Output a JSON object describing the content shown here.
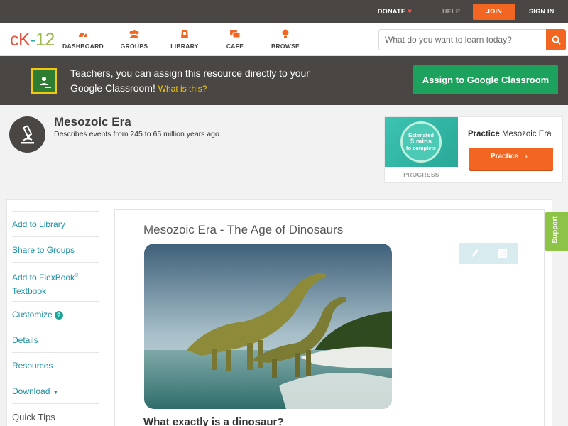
{
  "topbar": {
    "donate": "DONATE",
    "help": "HELP",
    "join": "JOIN",
    "signin": "SIGN IN"
  },
  "header": {
    "logo": {
      "l1": "cK",
      "l2": "-",
      "l3": "12"
    },
    "nav": [
      {
        "label": "DASHBOARD",
        "icon": "dashboard-icon"
      },
      {
        "label": "GROUPS",
        "icon": "groups-icon"
      },
      {
        "label": "LIBRARY",
        "icon": "library-icon"
      },
      {
        "label": "CAFE",
        "icon": "cafe-icon"
      },
      {
        "label": "BROWSE",
        "icon": "browse-icon"
      }
    ],
    "search_placeholder": "What do you want to learn today?"
  },
  "banner": {
    "text": "Teachers, you can assign this resource directly to your Google Classroom!",
    "link": "What is this?",
    "button": "Assign to Google Classroom"
  },
  "concept": {
    "title": "Mesozoic Era",
    "description": "Describes events from 245 to 65 million years ago."
  },
  "practice": {
    "estimated_line1": "Estimated",
    "estimated_line2": "5 mins",
    "estimated_line3": "to complete",
    "progress_label": "PROGRESS",
    "heading_bold": "Practice",
    "heading_rest": "Mesozoic Era",
    "button": "Practice"
  },
  "sidebar": {
    "items": [
      {
        "label": "Add to Library"
      },
      {
        "label": "Share to Groups"
      },
      {
        "label": "Add to FlexBook",
        "sup": "®",
        "line2": "Textbook"
      },
      {
        "label": "Customize"
      },
      {
        "label": "Details"
      },
      {
        "label": "Resources"
      },
      {
        "label": "Download"
      },
      {
        "label": "Quick Tips"
      }
    ],
    "customize_help": "?"
  },
  "article": {
    "title": "Mesozoic Era - The Age of Dinosaurs",
    "heading": "What exactly is a dinosaur?"
  },
  "support_tab": "Support",
  "colors": {
    "brand_orange": "#f26622",
    "teal_link": "#1a8ea3",
    "google_green": "#1ca25c",
    "dark_bar": "#4a4643"
  }
}
